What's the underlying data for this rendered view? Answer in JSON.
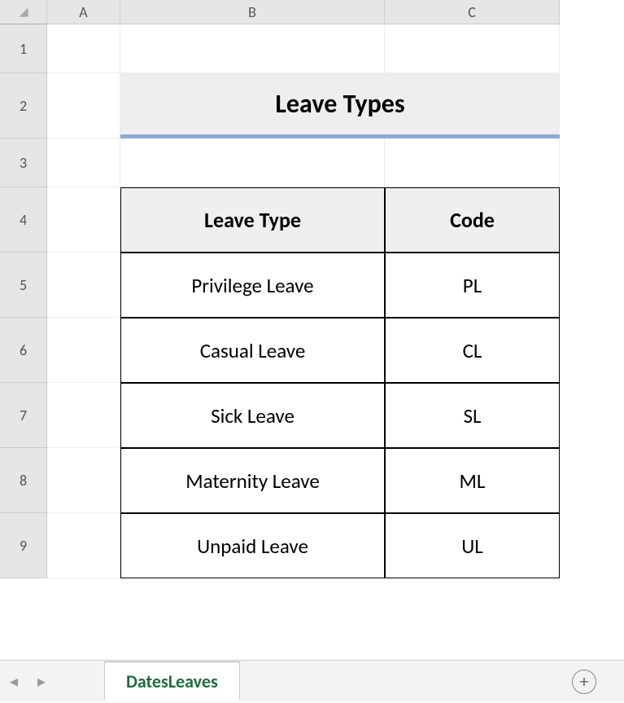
{
  "columns": [
    "A",
    "B",
    "C"
  ],
  "rows": [
    "1",
    "2",
    "3",
    "4",
    "5",
    "6",
    "7",
    "8",
    "9"
  ],
  "title": "Leave Types",
  "headers": {
    "type": "Leave Type",
    "code": "Code"
  },
  "data": [
    {
      "type": "Privilege Leave",
      "code": "PL"
    },
    {
      "type": "Casual Leave",
      "code": "CL"
    },
    {
      "type": "Sick Leave",
      "code": "SL"
    },
    {
      "type": "Maternity Leave",
      "code": "ML"
    },
    {
      "type": "Unpaid Leave",
      "code": "UL"
    }
  ],
  "tab": "DatesLeaves"
}
